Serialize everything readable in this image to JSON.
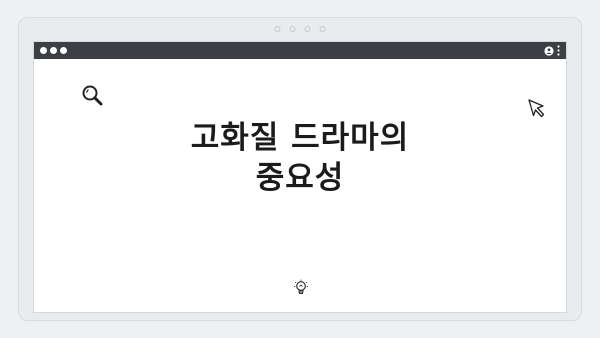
{
  "headline": {
    "line1": "고화질 드라마의",
    "line2": "중요성"
  },
  "icons": {
    "search": "search-icon",
    "cursor": "cursor-icon",
    "bulb": "lightbulb-icon",
    "user": "user-icon",
    "menu": "kebab-menu-icon"
  },
  "colors": {
    "titlebar": "#3c3f43",
    "background": "#eef1f3",
    "window": "#ffffff",
    "text": "#1b1b1b"
  }
}
